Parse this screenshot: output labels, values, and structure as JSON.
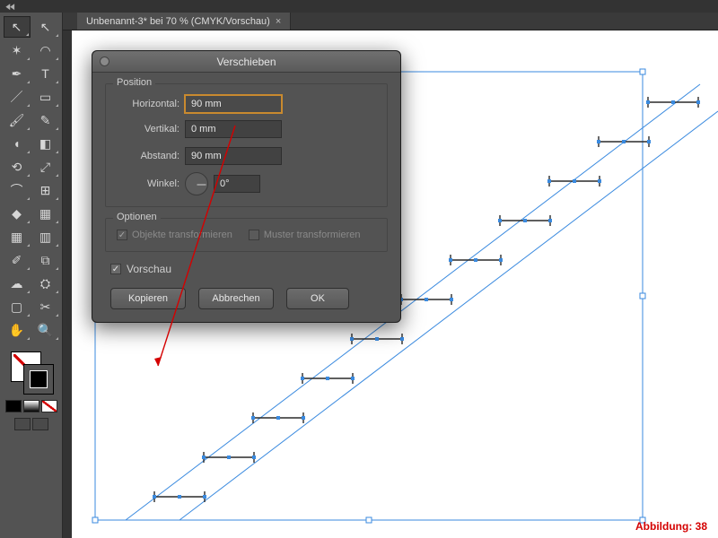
{
  "menubar": {
    "collapse_glyph": "◀◀"
  },
  "tab": {
    "title": "Unbenannt-3* bei 70 % (CMYK/Vorschau)",
    "close": "×"
  },
  "tools": {
    "items": [
      "selection",
      "direct-selection",
      "magic-wand",
      "lasso",
      "pen",
      "type",
      "line-segment",
      "rectangle",
      "paintbrush",
      "pencil",
      "blob-brush",
      "eraser",
      "rotate",
      "scale",
      "width",
      "free-transform",
      "shape-builder",
      "perspective-grid",
      "mesh",
      "gradient",
      "eyedropper",
      "blend",
      "symbol-sprayer",
      "column-graph",
      "artboard",
      "slice",
      "hand",
      "zoom"
    ],
    "glyphs": [
      "↖",
      "↖",
      "✶",
      "◠",
      "✒",
      "T",
      "／",
      "▭",
      "🖌",
      "✎",
      "◖",
      "◧",
      "⟲",
      "⤢",
      "⌒",
      "⊞",
      "◆",
      "▦",
      "▦",
      "▥",
      "✐",
      "⧉",
      "☁",
      "⛭",
      "▢",
      "✂",
      "✋",
      "🔍"
    ]
  },
  "dialog": {
    "title": "Verschieben",
    "group_position": "Position",
    "label_horizontal": "Horizontal:",
    "label_vertical": "Vertikal:",
    "label_distance": "Abstand:",
    "label_angle": "Winkel:",
    "value_horizontal": "90 mm",
    "value_vertical": "0 mm",
    "value_distance": "90 mm",
    "value_angle": "0°",
    "group_options": "Optionen",
    "cb_transform_objects": "Objekte transformieren",
    "cb_transform_patterns": "Muster transformieren",
    "cb_preview": "Vorschau",
    "btn_copy": "Kopieren",
    "btn_cancel": "Abbrechen",
    "btn_ok": "OK"
  },
  "caption": "Abbildung: 38"
}
